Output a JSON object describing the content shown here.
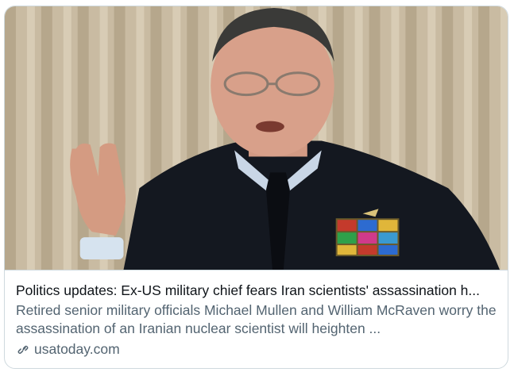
{
  "card": {
    "image_alt": "Man in dark naval uniform with medal ribbons gesturing while speaking",
    "title": "Politics updates: Ex-US military chief fears Iran scientists' assassination h...",
    "description": "Retired senior military officials Michael Mullen and William McRaven worry the assassination of an Iranian nuclear scientist will heighten ...",
    "source_domain": "usatoday.com",
    "source_icon": "link-icon"
  }
}
